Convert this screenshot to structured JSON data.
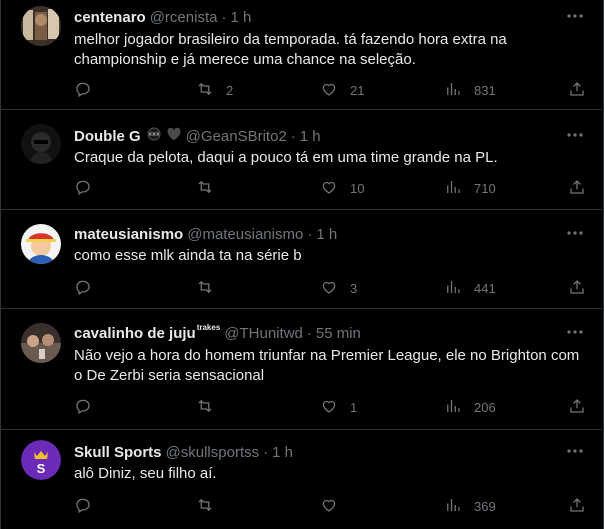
{
  "tweets": [
    {
      "name": "centenaro",
      "handle": "@rcenista",
      "time": "1 h",
      "text": "melhor jogador brasileiro da temporada. tá fazendo hora extra na championship e já merece uma chance na seleção.",
      "replies": "",
      "retweets": "2",
      "likes": "21",
      "views": "831"
    },
    {
      "name": "Double G",
      "handle": "@GeanSBrito2",
      "time": "1 h",
      "text": "Craque da pelota, daqui a pouco tá em uma time grande na PL.",
      "replies": "",
      "retweets": "",
      "likes": "10",
      "views": "710"
    },
    {
      "name": "mateusianismo",
      "handle": "@mateusianismo",
      "time": "1 h",
      "text": "como esse mlk ainda ta na série b",
      "replies": "",
      "retweets": "",
      "likes": "3",
      "views": "441"
    },
    {
      "name": "cavalinho de juju",
      "name_super": "trakes",
      "handle": "@THunitwd",
      "time": "55 min",
      "text": "Não vejo a hora do homem triunfar na Premier League, ele no Brighton com o De Zerbi seria sensacional",
      "replies": "",
      "retweets": "",
      "likes": "1",
      "views": "206"
    },
    {
      "name": "Skull Sports",
      "handle": "@skullsportss",
      "time": "1 h",
      "text": "alô Diniz, seu filho aí.",
      "replies": "",
      "retweets": "",
      "likes": "",
      "views": "369"
    }
  ],
  "dot": "·",
  "colors": {
    "background": "#000000",
    "text": "#e7e9ea",
    "muted": "#71767b",
    "divider": "#2f3336",
    "skull_purple": "#6b2bb8"
  },
  "icons": [
    "more-icon",
    "reply-icon",
    "retweet-icon",
    "like-icon",
    "views-icon",
    "share-icon"
  ]
}
